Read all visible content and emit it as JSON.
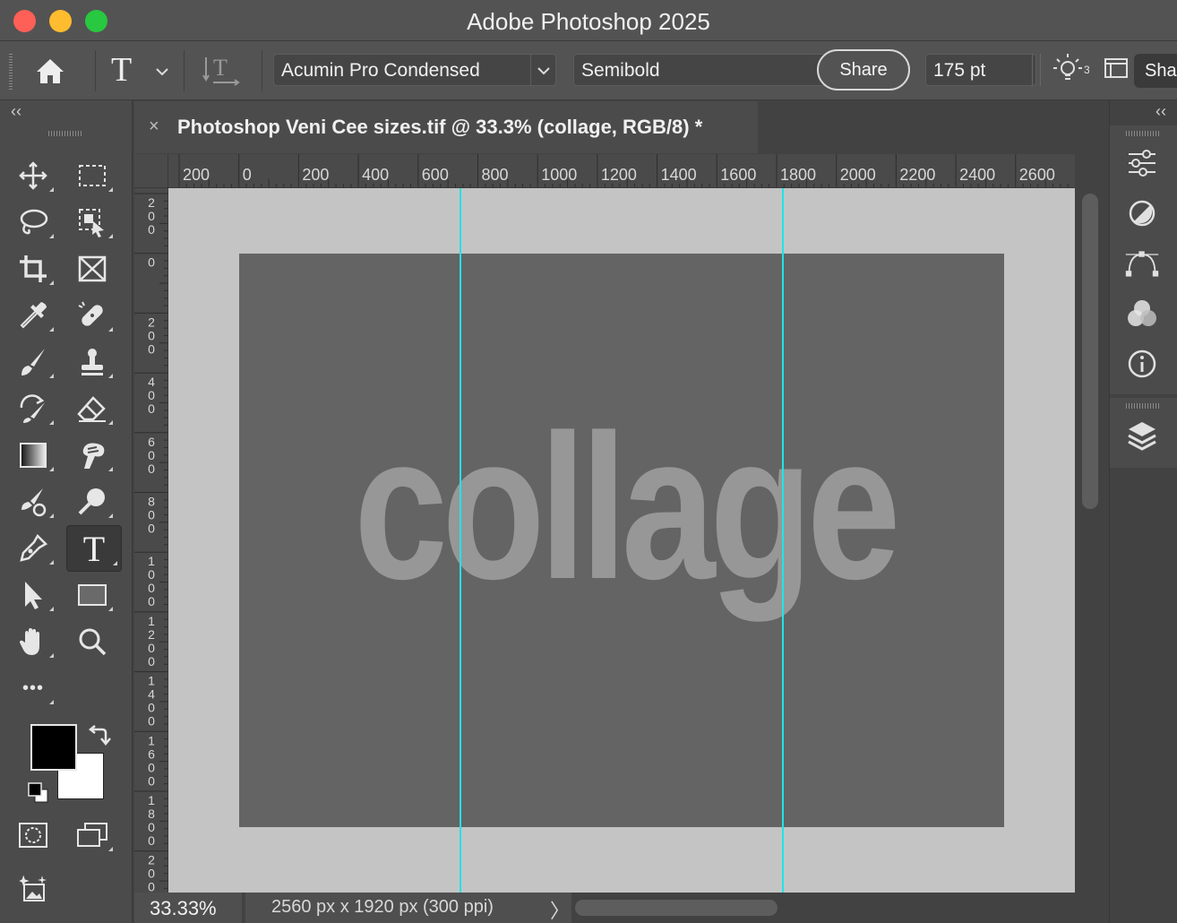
{
  "window": {
    "title": "Adobe Photoshop 2025",
    "traffic_lights": [
      "#fe5f57",
      "#febc2e",
      "#28c840"
    ]
  },
  "options_bar": {
    "tool_glyph": "T",
    "font_family": "Acumin Pro Condensed",
    "font_style": "Semibold",
    "share_label": "Share",
    "font_size": "175 pt",
    "share_cut_label": "Sha",
    "icons": [
      "home-icon",
      "type-tool-icon",
      "chevron-down-icon",
      "text-orientation-icon",
      "lightbulb-icon",
      "panel-icon"
    ]
  },
  "document": {
    "tab_title": "Photoshop Veni Cee sizes.tif @ 33.3% (collage, RGB/8) *",
    "close_glyph": "×",
    "canvas_text": "collage",
    "canvas_bg": "#c4c4c4",
    "artwork_bg": "#646464",
    "text_color": "#979797",
    "guide_color": "#22e3e6"
  },
  "rulers": {
    "horizontal": [
      "200",
      "0",
      "200",
      "400",
      "600",
      "800",
      "1000",
      "1200",
      "1400",
      "1600",
      "1800",
      "2000",
      "2200",
      "2400",
      "2600"
    ],
    "vertical": [
      "200",
      "0",
      "200",
      "400",
      "600",
      "800",
      "1000",
      "1200",
      "1400",
      "1600",
      "1800",
      "200"
    ]
  },
  "status": {
    "zoom": "33.33%",
    "doc_info": "2560 px x 1920 px (300 ppi)",
    "arrow": "〉"
  },
  "toolbar": {
    "collapse": "‹‹",
    "active_tool": "type-tool",
    "more": "•••"
  },
  "right_dock": {
    "collapse": "‹‹",
    "icons": [
      "adjustments-icon",
      "color-icon",
      "paths-icon",
      "channels-icon",
      "info-icon",
      "layers-icon"
    ]
  }
}
